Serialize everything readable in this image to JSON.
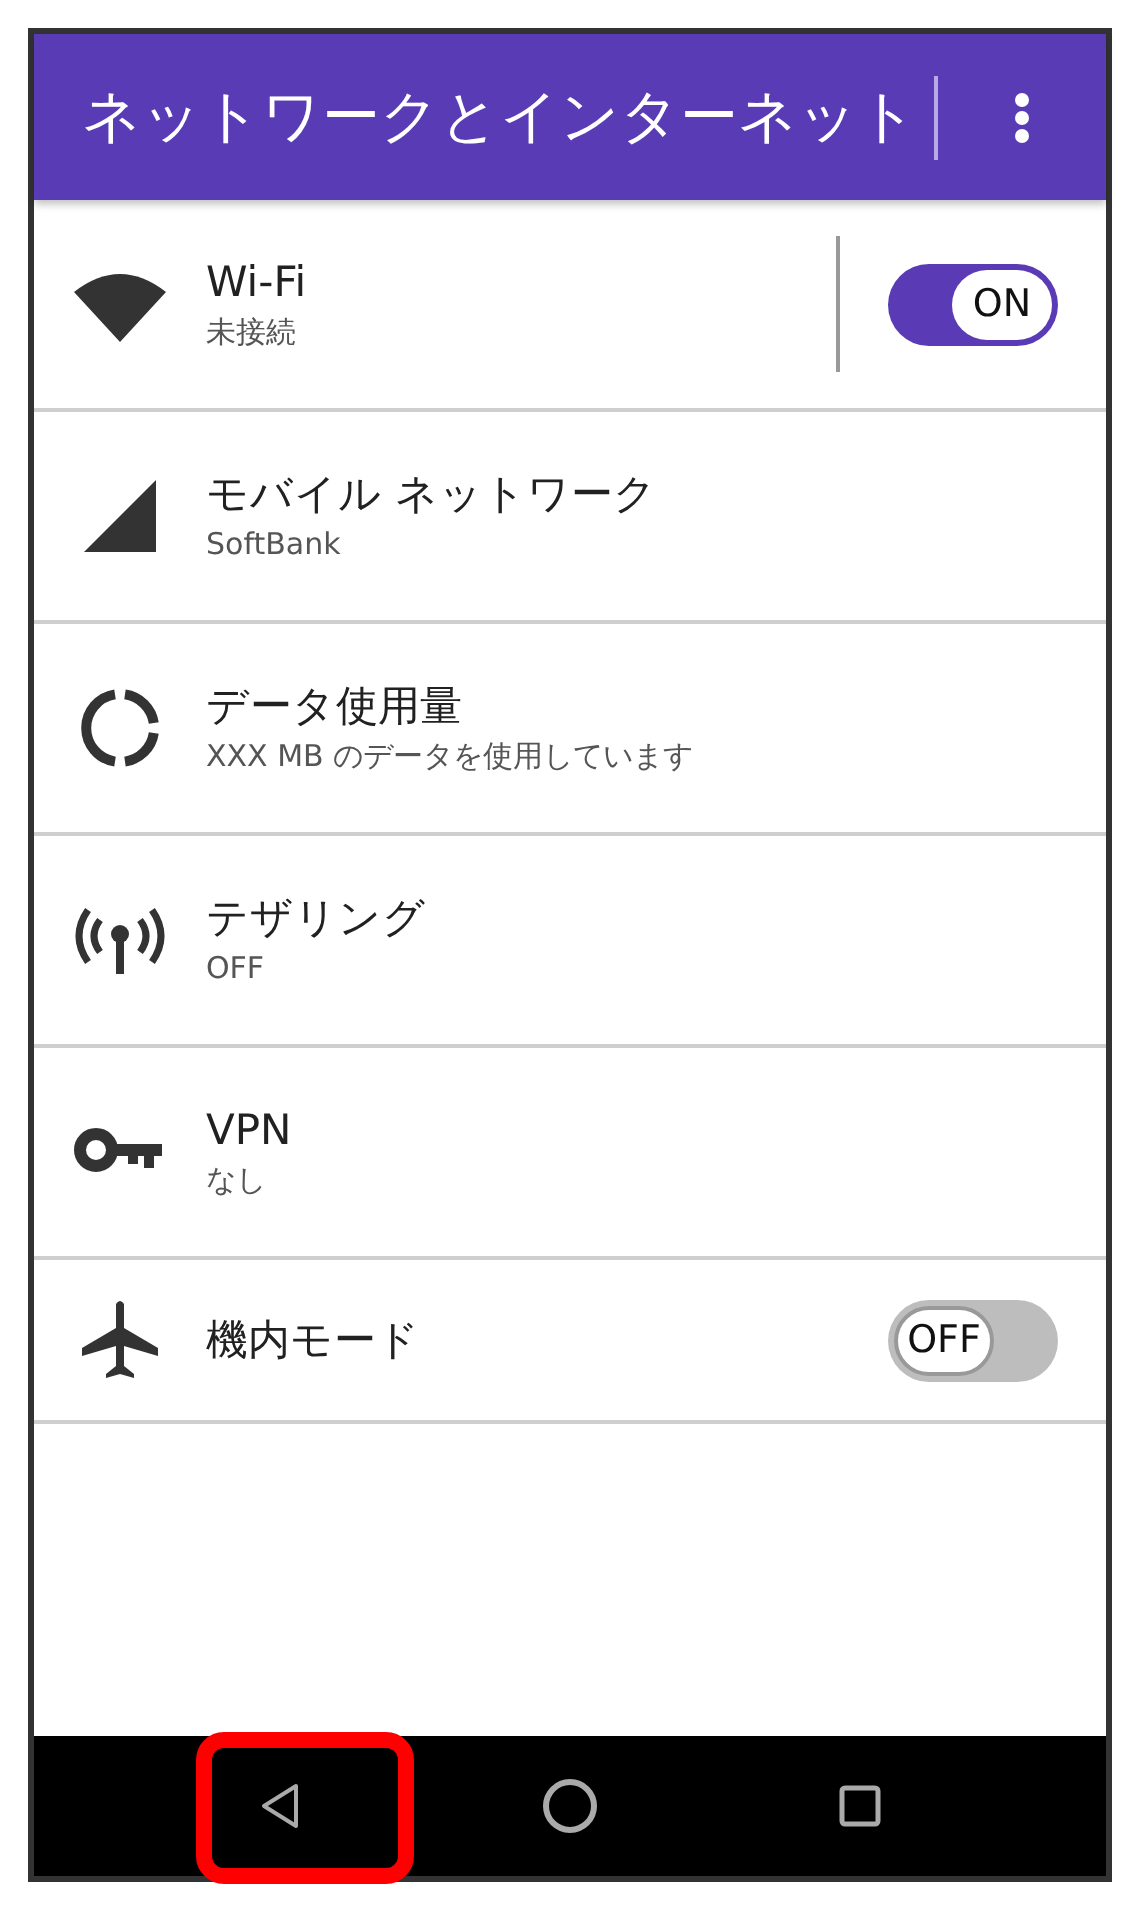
{
  "app_bar": {
    "title": "ネットワークとインターネット"
  },
  "items": [
    {
      "kind": "split-switch",
      "title": "Wi-Fi",
      "summary": "未接続",
      "switch": {
        "on": true,
        "label": "ON"
      }
    },
    {
      "kind": "plain",
      "title": "モバイル ネットワーク",
      "summary": "SoftBank"
    },
    {
      "kind": "plain",
      "title": "データ使用量",
      "summary": "XXX MB のデータを使用しています"
    },
    {
      "kind": "plain",
      "title": "テザリング",
      "summary": "OFF"
    },
    {
      "kind": "plain",
      "title": "VPN",
      "summary": "なし"
    },
    {
      "kind": "switch",
      "title": "機内モード",
      "switch": {
        "on": false,
        "label": "OFF"
      }
    }
  ],
  "nav_bar": {
    "buttons": [
      {
        "highlighted": true
      },
      {
        "highlighted": false
      },
      {
        "highlighted": false
      }
    ]
  }
}
